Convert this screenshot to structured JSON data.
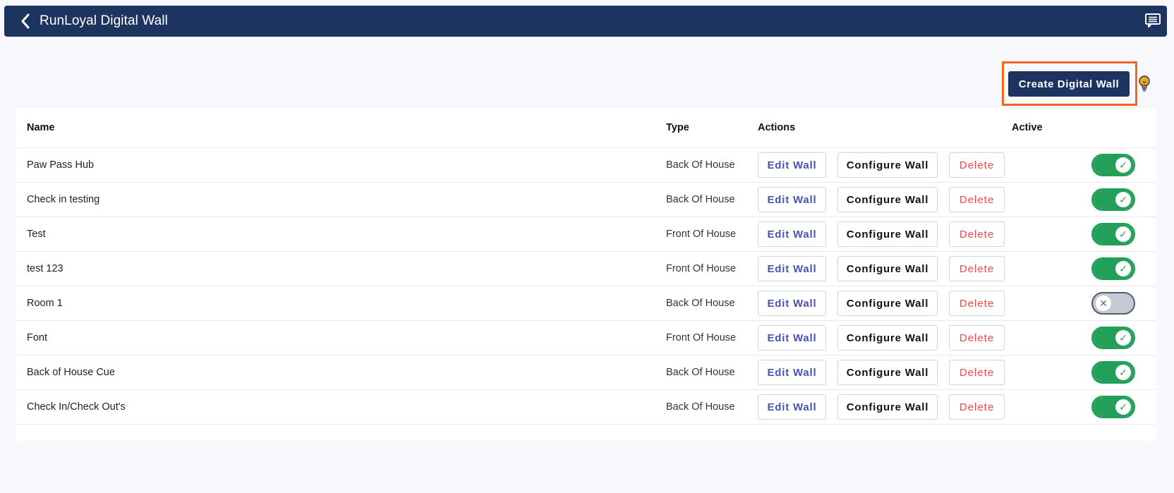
{
  "header": {
    "title": "RunLoyal Digital Wall",
    "back_icon": "chevron-left-icon",
    "chat_icon": "chat-icon"
  },
  "toolbar": {
    "create_label": "Create Digital Wall",
    "hint_icon": "lightbulb-icon"
  },
  "table": {
    "columns": {
      "name": "Name",
      "type": "Type",
      "actions": "Actions",
      "active": "Active"
    },
    "action_labels": {
      "edit": "Edit Wall",
      "configure": "Configure Wall",
      "delete": "Delete"
    },
    "rows": [
      {
        "name": "Paw Pass Hub",
        "type": "Back Of House",
        "active": true
      },
      {
        "name": "Check in testing",
        "type": "Back Of House",
        "active": true
      },
      {
        "name": "Test",
        "type": "Front Of House",
        "active": true
      },
      {
        "name": "test 123",
        "type": "Front Of House",
        "active": true
      },
      {
        "name": "Room 1",
        "type": "Back Of House",
        "active": false
      },
      {
        "name": "Font",
        "type": "Front Of House",
        "active": true
      },
      {
        "name": "Back of House Cue",
        "type": "Back Of House",
        "active": true
      },
      {
        "name": "Check In/Check Out's",
        "type": "Back Of House",
        "active": true
      }
    ]
  },
  "colors": {
    "brand": "#1d3460",
    "highlight": "#f26522",
    "active_green": "#22a05a",
    "delete_red": "#ee4545",
    "edit_blue": "#4a52b0"
  }
}
